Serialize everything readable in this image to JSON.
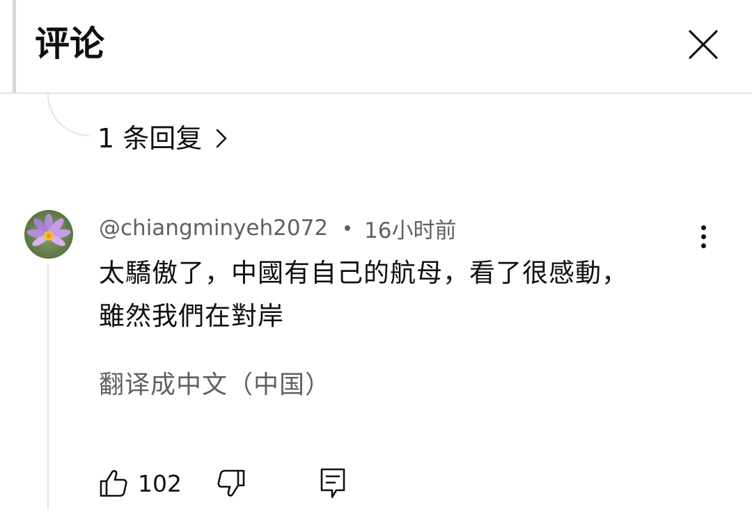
{
  "header": {
    "title": "评论"
  },
  "replies": {
    "label": "1 条回复"
  },
  "comment": {
    "author": "@chiangminyeh2072",
    "time": "16小时前",
    "text_line1": "太驕傲了，中國有自己的航母，看了很感動，",
    "text_line2": "雖然我們在對岸",
    "translate_label": "翻译成中文（中国）",
    "like_count": "102"
  },
  "icons": {
    "close": "close-icon",
    "chevron": "chevron-right-icon",
    "more": "more-vert-icon",
    "like": "thumb-up-icon",
    "dislike": "thumb-down-icon",
    "reply": "comment-icon"
  },
  "colors": {
    "primary_text": "#0f0f0f",
    "secondary_text": "#606060",
    "divider": "#e6e6e6"
  }
}
